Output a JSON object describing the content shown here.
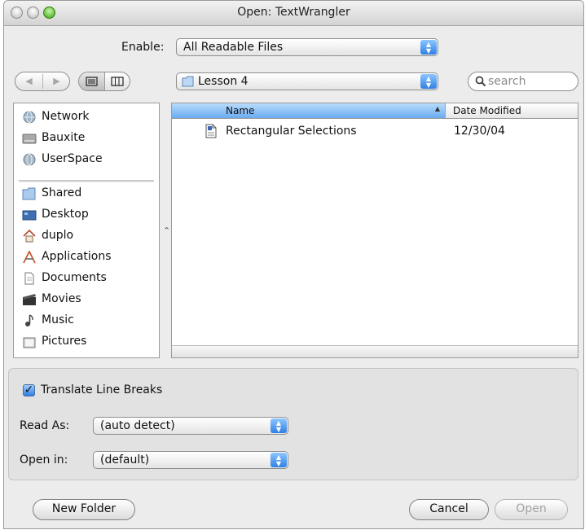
{
  "window": {
    "title": "Open: TextWrangler"
  },
  "enable": {
    "label": "Enable:",
    "value": "All Readable Files"
  },
  "location": {
    "value": "Lesson 4"
  },
  "search": {
    "placeholder": "search"
  },
  "sidebar": {
    "devices": [
      {
        "label": "Network",
        "icon": "network-icon"
      },
      {
        "label": "Bauxite",
        "icon": "hard-drive-icon"
      },
      {
        "label": "UserSpace",
        "icon": "network-volume-icon"
      }
    ],
    "places": [
      {
        "label": "Shared",
        "icon": "folder-icon"
      },
      {
        "label": "Desktop",
        "icon": "desktop-icon"
      },
      {
        "label": "duplo",
        "icon": "home-icon"
      },
      {
        "label": "Applications",
        "icon": "applications-icon"
      },
      {
        "label": "Documents",
        "icon": "documents-icon"
      },
      {
        "label": "Movies",
        "icon": "movies-icon"
      },
      {
        "label": "Music",
        "icon": "music-icon"
      },
      {
        "label": "Pictures",
        "icon": "pictures-icon"
      }
    ]
  },
  "file_list": {
    "columns": {
      "name": "Name",
      "date": "Date Modified"
    },
    "rows": [
      {
        "name": "Rectangular Selections",
        "date": "12/30/04",
        "icon": "text-document-icon"
      }
    ]
  },
  "options": {
    "translate_line_breaks": {
      "label": "Translate Line Breaks",
      "checked": true
    },
    "read_as": {
      "label": "Read As:",
      "value": "(auto detect)"
    },
    "open_in": {
      "label": "Open in:",
      "value": "(default)"
    }
  },
  "buttons": {
    "new_folder": "New Folder",
    "cancel": "Cancel",
    "open": "Open"
  },
  "colors": {
    "selection_blue": "#6aaaf0",
    "accent_blue": "#2f7fe6"
  }
}
